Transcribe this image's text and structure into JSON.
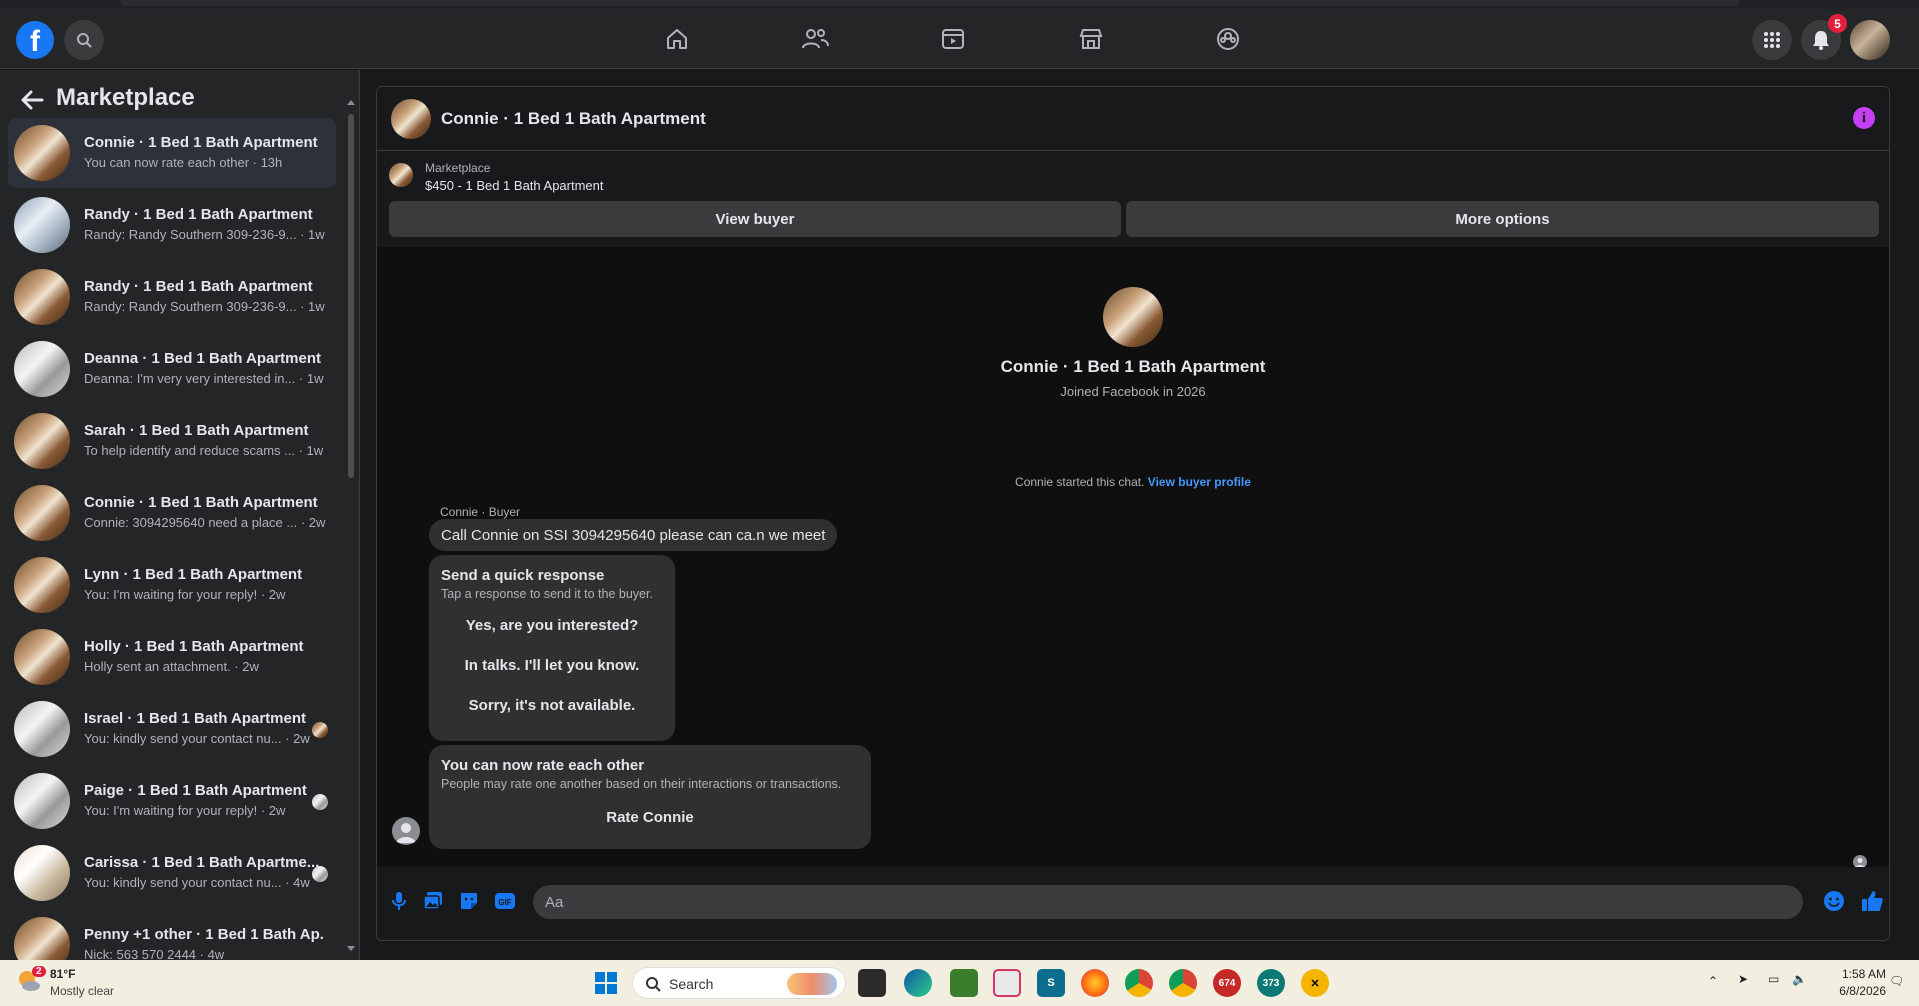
{
  "nav": {
    "notifications_count": "5"
  },
  "sidebar": {
    "title": "Marketplace",
    "conversations": [
      {
        "name": "Connie · 1 Bed 1 Bath Apartment",
        "snippet": "You can now rate each other · 13h",
        "active": true
      },
      {
        "name": "Randy · 1 Bed 1 Bath Apartment",
        "snippet": "Randy: Randy Southern 309-236-9... · 1w"
      },
      {
        "name": "Randy · 1 Bed 1 Bath Apartment",
        "snippet": "Randy: Randy Southern 309-236-9... · 1w"
      },
      {
        "name": "Deanna · 1 Bed 1 Bath Apartment",
        "snippet": "Deanna: I'm very very interested in... · 1w"
      },
      {
        "name": "Sarah · 1 Bed 1 Bath Apartment",
        "snippet": "To help identify and reduce scams ... · 1w"
      },
      {
        "name": "Connie · 1 Bed 1 Bath Apartment",
        "snippet": "Connie: 3094295640 need a place ... · 2w"
      },
      {
        "name": "Lynn · 1 Bed 1 Bath Apartment",
        "snippet": "You: I'm waiting for your reply! · 2w"
      },
      {
        "name": "Holly · 1 Bed 1 Bath Apartment",
        "snippet": "Holly sent an attachment. · 2w"
      },
      {
        "name": "Israel · 1 Bed 1 Bath Apartment",
        "snippet": "You: kindly send your contact nu... · 2w"
      },
      {
        "name": "Paige · 1 Bed 1 Bath Apartment",
        "snippet": "You: I'm waiting for your reply! · 2w"
      },
      {
        "name": "Carissa · 1 Bed 1 Bath Apartme...",
        "snippet": "You: kindly send your contact nu... · 4w"
      },
      {
        "name": "Penny +1 other · 1 Bed 1 Bath Ap...",
        "snippet": "Nick: 563 570 2444 · 4w"
      }
    ]
  },
  "chat": {
    "title": "Connie · 1 Bed 1 Bath Apartment",
    "listing_source": "Marketplace",
    "listing_title": "$450 - 1 Bed 1 Bath Apartment",
    "view_buyer": "View buyer",
    "more_options": "More options",
    "profile_name": "Connie · 1 Bed 1 Bath Apartment",
    "profile_sub": "Joined Facebook in 2026",
    "started_text": "Connie started this chat.",
    "view_buyer_profile": "View buyer profile",
    "sender_label": "Connie · Buyer",
    "message": "Call Connie on SSI 3094295640 please can ca.n we meet",
    "quick_response": {
      "heading": "Send a quick response",
      "sub": "Tap a response to send it to the buyer.",
      "options": [
        "Yes, are you interested?",
        "In talks. I'll let you know.",
        "Sorry, it's not available."
      ]
    },
    "rate": {
      "heading": "You can now rate each other",
      "sub": "People may rate one another based on their interactions or transactions.",
      "button": "Rate Connie"
    },
    "input_placeholder": "Aa"
  },
  "taskbar": {
    "weather_temp": "81°F",
    "weather_desc": "Mostly clear",
    "weather_badge": "2",
    "search_label": "Search",
    "app_badge_1": "674",
    "app_badge_2": "373",
    "time": "1:58 AM",
    "date": "6/8/2026"
  },
  "colors": {
    "accent": "#1877f2",
    "info": "#c540f5",
    "link": "#4599ff"
  }
}
